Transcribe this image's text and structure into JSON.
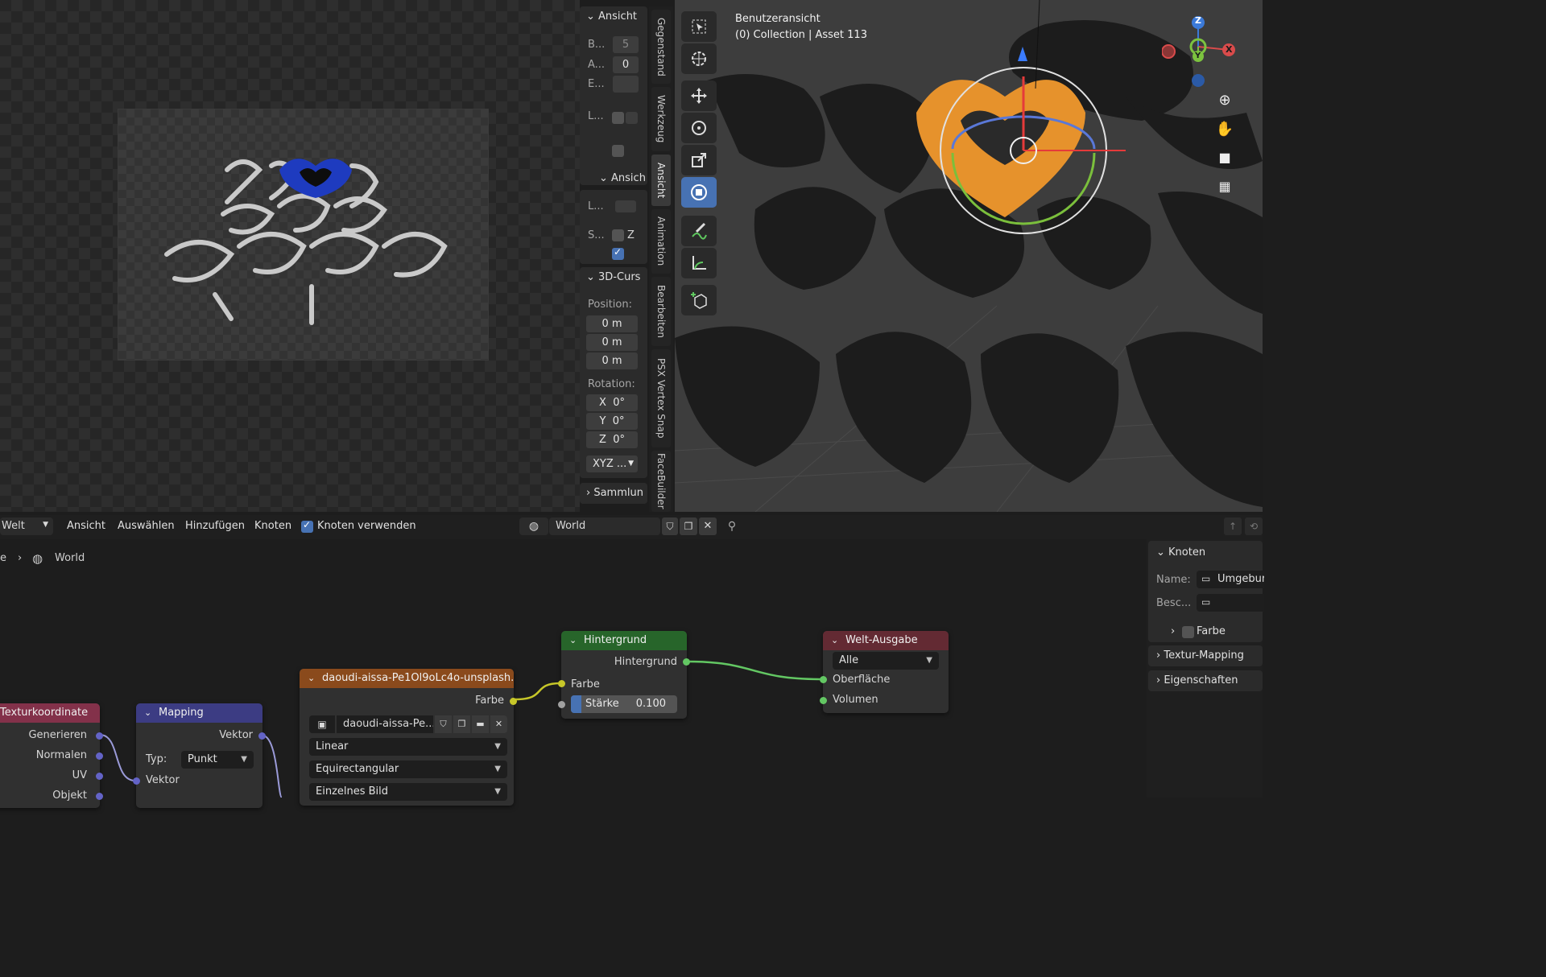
{
  "image_editor": {
    "preview_text": "artwork preview"
  },
  "npanel": {
    "section_view": "Ansicht",
    "field_b_label": "B...",
    "field_b_value": "5",
    "field_a_label": "A...",
    "field_a_value": "0",
    "field_e_label": "E...",
    "field_l_label": "L...",
    "section_view2": "Ansich",
    "field_l2_label": "L...",
    "field_s_label": "S...",
    "z_label": "Z",
    "section_cursor": "3D-Curs",
    "position_label": "Position:",
    "position_values": [
      "0 m",
      "0 m",
      "0 m"
    ],
    "rotation_label": "Rotation:",
    "rotation_axes": [
      "X",
      "Y",
      "Z"
    ],
    "rotation_values": [
      "0°",
      "0°",
      "0°"
    ],
    "rotation_mode": "XYZ ...",
    "section_collection": "Sammlun",
    "tabs": [
      "Gegenstand",
      "Werkzeug",
      "Ansicht",
      "Animation",
      "Bearbeiten",
      "PSX Vertex Snap",
      "FaceBuilder"
    ],
    "active_tab": "Ansicht"
  },
  "viewport": {
    "title": "Benutzeransicht",
    "subtitle": "(0) Collection | Asset 113",
    "gizmo_axes": [
      "Z",
      "Y",
      "X"
    ]
  },
  "node_editor": {
    "world_dropdown": "Welt",
    "menu": [
      "Ansicht",
      "Auswählen",
      "Hinzufügen",
      "Knoten"
    ],
    "use_nodes_label": "Knoten verwenden",
    "use_nodes_checked": true,
    "world_name": "World",
    "breadcrumb_world": "World",
    "nodes": {
      "texcoord": {
        "title": "Texturkoordinate",
        "outputs": [
          "Generieren",
          "Normalen",
          "UV",
          "Objekt"
        ]
      },
      "mapping": {
        "title": "Mapping",
        "output": "Vektor",
        "type_label": "Typ:",
        "type_value": "Punkt",
        "input": "Vektor"
      },
      "envtex": {
        "title": "daoudi-aissa-Pe1Ol9oLc4o-unsplash.j...",
        "output": "Farbe",
        "image_name": "daoudi-aissa-Pe...",
        "interpolation": "Linear",
        "projection": "Equirectangular",
        "source": "Einzelnes Bild"
      },
      "background": {
        "title": "Hintergrund",
        "output": "Hintergrund",
        "input_color": "Farbe",
        "strength_label": "Stärke",
        "strength_value": "0.100"
      },
      "world_output": {
        "title": "Welt-Ausgabe",
        "target": "Alle",
        "input_surface": "Oberfläche",
        "input_volume": "Volumen"
      }
    }
  },
  "side_panel": {
    "section_node": "Knoten",
    "name_label": "Name:",
    "name_value": "Umgebur",
    "desc_label": "Besc...",
    "color_label": "Farbe",
    "texture_mapping": "Textur-Mapping",
    "properties": "Eigenschaften"
  },
  "colors": {
    "active_blue": "#4772b3",
    "texcoord_header": "#83314a",
    "mapping_header": "#3c3c83",
    "envtex_header": "#8a4a1c",
    "background_header": "#27652a",
    "output_header": "#632a33"
  }
}
